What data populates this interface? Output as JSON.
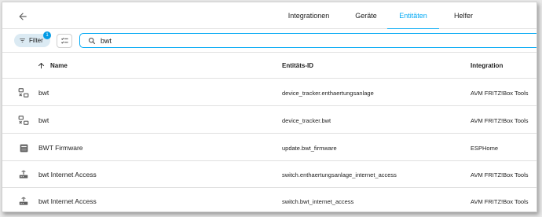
{
  "header": {
    "tabs": [
      {
        "label": "Integrationen",
        "active": false
      },
      {
        "label": "Geräte",
        "active": false
      },
      {
        "label": "Entitäten",
        "active": true
      },
      {
        "label": "Helfer",
        "active": false
      }
    ],
    "accent_color": "#03a9f4"
  },
  "toolbar": {
    "filter_label": "Filter",
    "filter_count": "1",
    "search_value": "bwt"
  },
  "table": {
    "columns": [
      "Name",
      "Entitäts-ID",
      "Integration"
    ],
    "sort_column": "Name",
    "sort_direction": "ascending",
    "rows": [
      {
        "icon": "device-tracker-icon",
        "name": "bwt",
        "entity_id": "device_tracker.enthaertungsanlage",
        "integration": "AVM FRITZ!Box Tools"
      },
      {
        "icon": "device-tracker-icon",
        "name": "bwt",
        "entity_id": "device_tracker.bwt",
        "integration": "AVM FRITZ!Box Tools"
      },
      {
        "icon": "package-update-icon",
        "name": "BWT Firmware",
        "entity_id": "update.bwt_firmware",
        "integration": "ESPHome"
      },
      {
        "icon": "router-wireless-icon",
        "name": "bwt Internet Access",
        "entity_id": "switch.enthaertungsanlage_internet_access",
        "integration": "AVM FRITZ!Box Tools"
      },
      {
        "icon": "router-wireless-icon",
        "name": "bwt Internet Access",
        "entity_id": "switch.bwt_internet_access",
        "integration": "AVM FRITZ!Box Tools"
      }
    ]
  }
}
